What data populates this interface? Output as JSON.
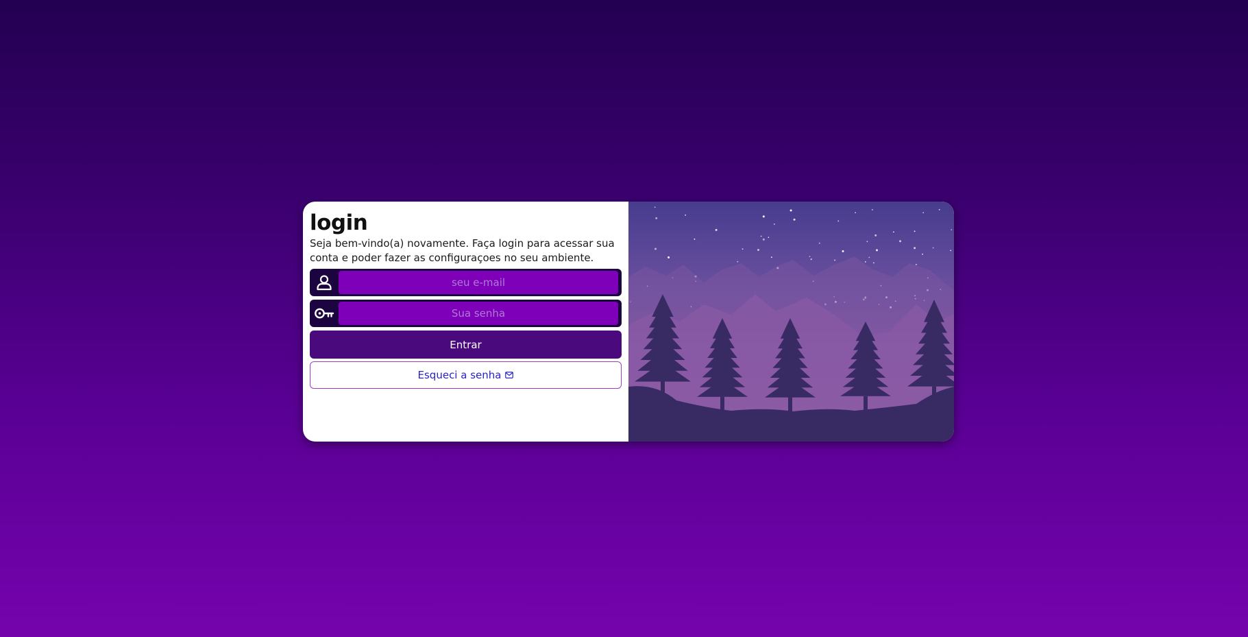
{
  "login": {
    "title": "login",
    "subtitle": "Seja bem-vindo(a) novamente. Faça login para acessar sua conta e poder fazer as configuraçoes no seu ambiente.",
    "email_placeholder": "seu e-mail",
    "password_placeholder": "Sua senha",
    "submit_label": "Entrar",
    "forgot_label": "Esqueci a senha"
  },
  "icons": {
    "email_field": "user-icon",
    "password_field": "key-icon",
    "forgot_button": "envelope-icon",
    "illustration": "night-forest-illustration"
  },
  "colors": {
    "background_top": "#230051",
    "background_bottom": "#7503ad",
    "field_frame": "#1c0440",
    "field_fill": "#7e00b8",
    "primary_button": "#4a0a7e",
    "link_text": "#2a23c7",
    "outline_border": "#a03cc4"
  }
}
